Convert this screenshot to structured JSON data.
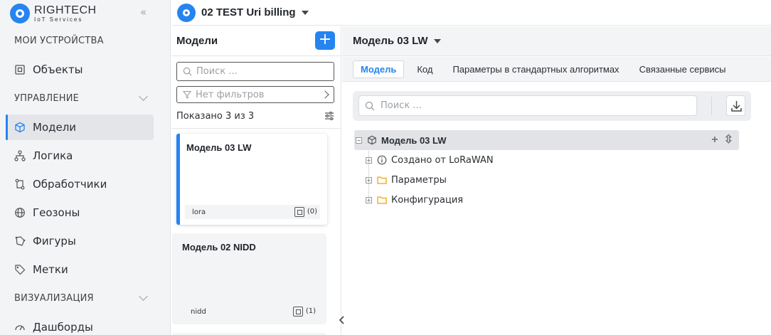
{
  "brand": {
    "name": "RIGHTECH",
    "subtitle": "IoT Services"
  },
  "sidebar": {
    "sections": [
      {
        "title": "МОИ УСТРОЙСТВА"
      },
      {
        "title": "УПРАВЛЕНИЕ"
      },
      {
        "title": "ВИЗУАЛИЗАЦИЯ"
      }
    ],
    "items": [
      {
        "label": "Объекты",
        "icon": "object-icon"
      },
      {
        "label": "Модели",
        "icon": "cube-icon",
        "active": true
      },
      {
        "label": "Логика",
        "icon": "logic-icon"
      },
      {
        "label": "Обработчики",
        "icon": "handlers-icon"
      },
      {
        "label": "Геозоны",
        "icon": "globe-icon"
      },
      {
        "label": "Фигуры",
        "icon": "shapes-icon"
      },
      {
        "label": "Метки",
        "icon": "tag-icon"
      },
      {
        "label": "Дашборды",
        "icon": "dashboard-icon"
      }
    ]
  },
  "header": {
    "project": "02 TEST Uri billing"
  },
  "models_panel": {
    "title": "Модели",
    "add_label": "+",
    "search_placeholder": "Поиск ...",
    "filter_label": "Нет фильтров",
    "shown": "Показано 3 из 3",
    "cards": [
      {
        "name": "Модель 03 LW",
        "tag": "lora",
        "count": "(0)",
        "selected": true
      },
      {
        "name": "Модель 02 NIDD",
        "tag": "nidd",
        "count": "(1)",
        "selected": false
      }
    ]
  },
  "detail": {
    "title": "Модель 03 LW",
    "tabs": [
      {
        "label": "Модель",
        "active": true
      },
      {
        "label": "Код"
      },
      {
        "label": "Параметры в стандартных алгоритмах"
      },
      {
        "label": "Связанные сервисы"
      }
    ],
    "search_placeholder": "Поиск ...",
    "tree": {
      "root": "Модель 03 LW",
      "children": [
        {
          "label": "Создано от LoRaWAN",
          "icon": "info-icon"
        },
        {
          "label": "Параметры",
          "icon": "folder-icon"
        },
        {
          "label": "Конфигурация",
          "icon": "folder-icon"
        }
      ]
    }
  },
  "colors": {
    "accent": "#2584f0",
    "sidebar_bg": "#f3f4f6",
    "folder": "#f0a500"
  }
}
